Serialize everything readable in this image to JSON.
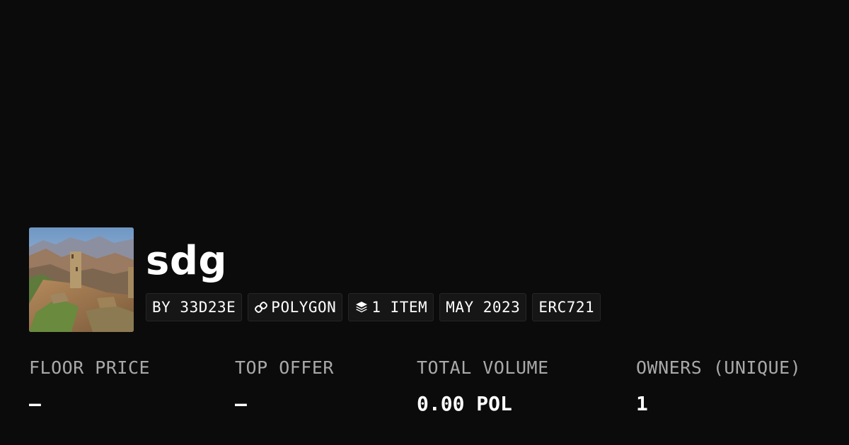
{
  "collection": {
    "name": "sdg",
    "thumbnail": "collection-thumbnail-mountain-tower",
    "tags": [
      {
        "label": "BY 33D23E",
        "icon": ""
      },
      {
        "label": "POLYGON",
        "icon": "link-icon"
      },
      {
        "label": "1 ITEM",
        "icon": "layers-icon"
      },
      {
        "label": "MAY 2023",
        "icon": ""
      },
      {
        "label": "ERC721",
        "icon": ""
      }
    ]
  },
  "stats": [
    {
      "label": "FLOOR PRICE",
      "value": "–"
    },
    {
      "label": "TOP OFFER",
      "value": "–"
    },
    {
      "label": "TOTAL VOLUME",
      "value": "0.00 POL"
    },
    {
      "label": "OWNERS (UNIQUE)",
      "value": "1"
    }
  ],
  "colors": {
    "background": "#0b0b0b",
    "tag_background": "#161616",
    "label_gray": "#a9a9a9",
    "text": "#ffffff"
  }
}
